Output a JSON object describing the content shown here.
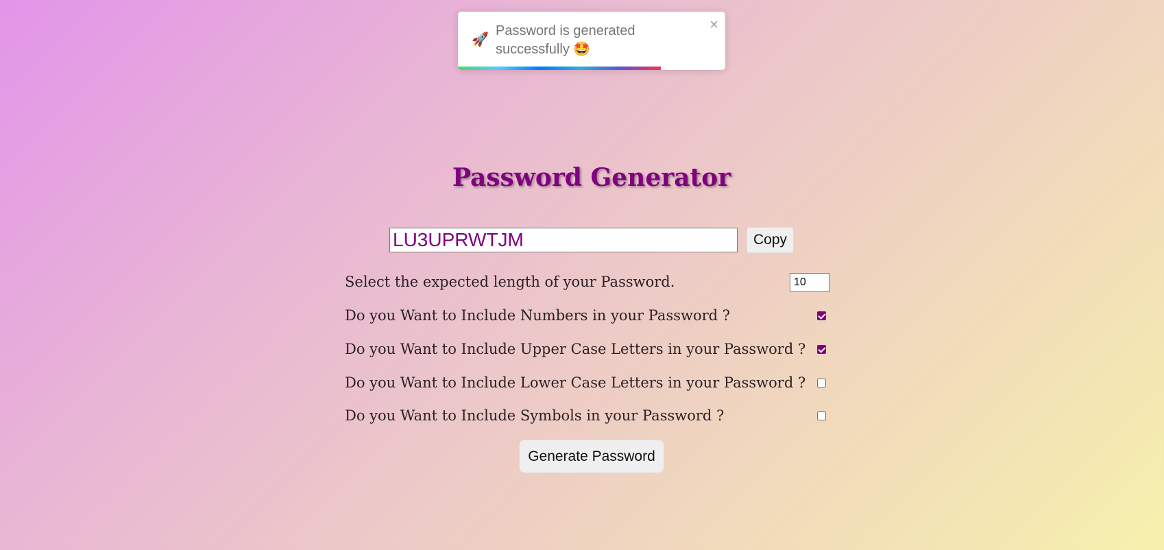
{
  "toast": {
    "icon": "🚀",
    "icon_name": "rocket-icon",
    "message": "Password is generated successfully 🤩",
    "close": "×",
    "progress": 0.76
  },
  "app": {
    "title": "Password Generator"
  },
  "output": {
    "password": "LU3UPRWTJM",
    "copy_label": "Copy"
  },
  "options": {
    "length_label": "Select the expected length of your Password.",
    "length_value": "10",
    "numbers": {
      "label": "Do you Want to Include Numbers in your Password ?",
      "checked": true
    },
    "upper": {
      "label": "Do you Want to Include Upper Case Letters in your Password ?",
      "checked": true
    },
    "lower": {
      "label": "Do you Want to Include Lower Case Letters in your Password ?",
      "checked": false
    },
    "symbols": {
      "label": "Do you Want to Include Symbols in your Password ?",
      "checked": false
    }
  },
  "generate_label": "Generate Password",
  "colors": {
    "accent": "#800080"
  }
}
